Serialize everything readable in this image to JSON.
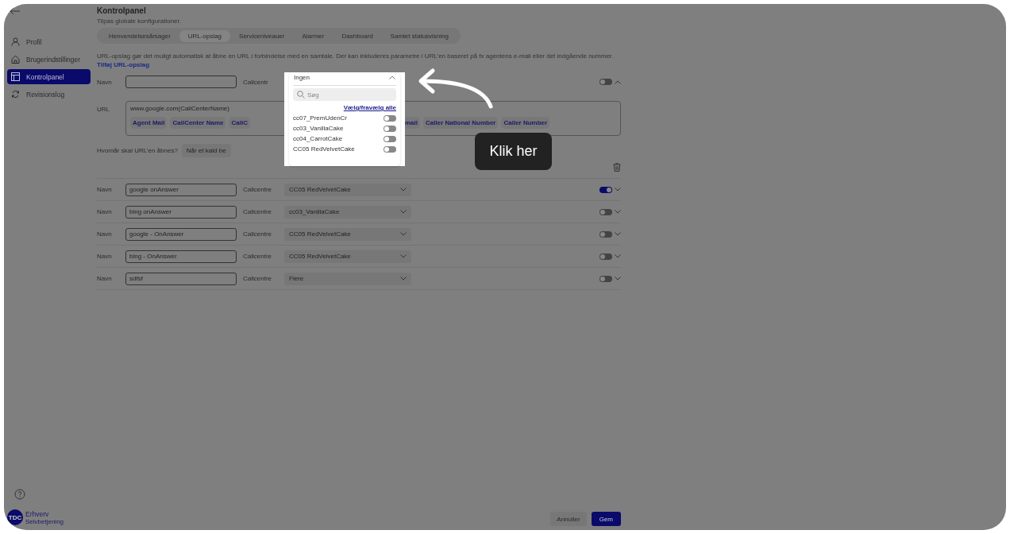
{
  "sidebar": {
    "items": [
      {
        "label": "Profil",
        "kind": "person",
        "selected": false
      },
      {
        "label": "Brugerindstillinger",
        "kind": "home",
        "selected": false
      },
      {
        "label": "Kontrolpanel",
        "kind": "panel",
        "selected": true
      },
      {
        "label": "Revisionslog",
        "kind": "sync",
        "selected": false
      }
    ]
  },
  "header": {
    "title": "Kontrolpanel",
    "subtitle": "Tilpas globale konfigurationer."
  },
  "tabs": [
    {
      "label": "Henvendelsesårsager",
      "selected": false
    },
    {
      "label": "URL-opslag",
      "selected": true
    },
    {
      "label": "Serviceniveauer",
      "selected": false
    },
    {
      "label": "Alarmer",
      "selected": false
    },
    {
      "label": "Dashboard",
      "selected": false
    },
    {
      "label": "Samlet statusvisning",
      "selected": false
    }
  ],
  "description": {
    "text": "URL-opslag gør det muligt automatisk at åbne en URL i forbindelse med en samtale. Der kan inkluderes parametre i URL’en baseret på fx agentens e-mail eller det indgående nummer.",
    "link": "Tilføj URL-opslag"
  },
  "editor": {
    "name_label": "Navn",
    "callcentre_label": "Callcentr",
    "on": false,
    "expanded": true,
    "url_label": "URL",
    "url_value": "www.google.com(CallCenterName)",
    "chips_left": [
      "Agent Mail",
      "CallCenter Name",
      "CallC"
    ],
    "chips_right": [
      "mail",
      "Caller National Number",
      "Caller Number"
    ],
    "open_label": "Hvornår skal URL’en åbnes?",
    "open_value": "Når et kald be"
  },
  "dropdown": {
    "value": "Ingen",
    "expanded": true,
    "search_placeholder": "Søg",
    "select_all": "Vælg/fravælg alle",
    "options": [
      {
        "label": "cc07_PremUdenCr",
        "on": false
      },
      {
        "label": "cc03_VanillaCake",
        "on": false
      },
      {
        "label": "cc04_CarrotCake",
        "on": false
      },
      {
        "label": "CC05 RedVelvetCake",
        "on": false
      }
    ]
  },
  "rows": [
    {
      "name_label": "Navn",
      "name": "google onAnswer",
      "callcentre_label": "Callcentre",
      "callcentre": "CC05 RedVelvetCake",
      "on": true,
      "expanded": false
    },
    {
      "name_label": "Navn",
      "name": "bing onAnswer",
      "callcentre_label": "Callcentre",
      "callcentre": "cc03_VanillaCake",
      "on": false,
      "expanded": false
    },
    {
      "name_label": "Navn",
      "name": "google - OnAnswer",
      "callcentre_label": "Callcentre",
      "callcentre": "CC05 RedVelvetCake",
      "on": false,
      "expanded": false
    },
    {
      "name_label": "Navn",
      "name": "bing - OnAnswer",
      "callcentre_label": "Callcentre",
      "callcentre": "CC05 RedVelvetCake",
      "on": false,
      "expanded": false
    },
    {
      "name_label": "Navn",
      "name": "sdfsf",
      "callcentre_label": "Callcentre",
      "callcentre": "Flere",
      "on": false,
      "expanded": false
    }
  ],
  "footer": {
    "cancel": "Annuller",
    "save": "Gem"
  },
  "logo": {
    "mark": "TDC",
    "name": "Erhverv",
    "sub": "Selvbetjening"
  },
  "callout": {
    "text": "Klik her"
  }
}
